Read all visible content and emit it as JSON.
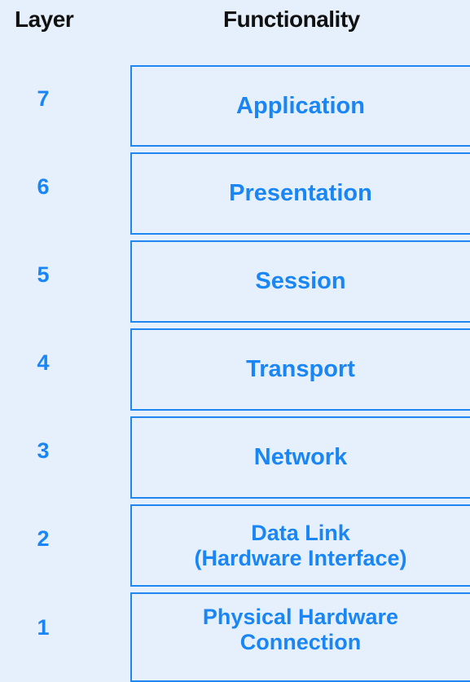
{
  "headers": {
    "layer": "Layer",
    "functionality": "Functionality"
  },
  "layers": [
    {
      "number": "7",
      "line1": "Application",
      "line2": ""
    },
    {
      "number": "6",
      "line1": "Presentation",
      "line2": ""
    },
    {
      "number": "5",
      "line1": "Session",
      "line2": ""
    },
    {
      "number": "4",
      "line1": "Transport",
      "line2": ""
    },
    {
      "number": "3",
      "line1": "Network",
      "line2": ""
    },
    {
      "number": "2",
      "line1": "Data Link",
      "line2": "(Hardware Interface)"
    },
    {
      "number": "1",
      "line1": "Physical Hardware",
      "line2": "Connection"
    }
  ],
  "colors": {
    "background": "#e5f0fc",
    "accent": "#1a86f5",
    "header": "#111111"
  }
}
